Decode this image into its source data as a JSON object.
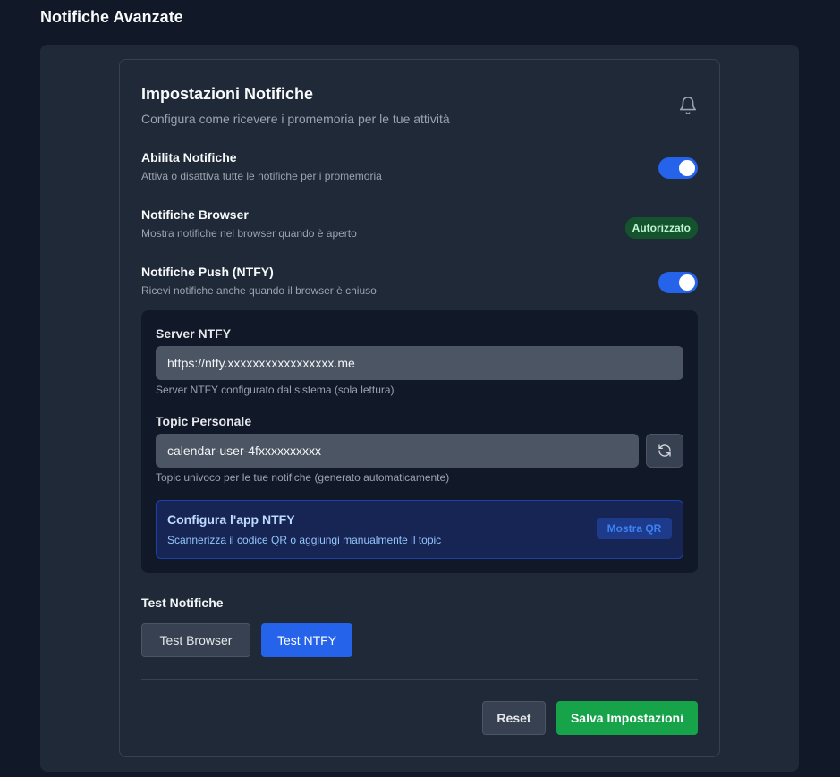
{
  "page": {
    "title": "Notifiche Avanzate"
  },
  "card": {
    "title": "Impostazioni Notifiche",
    "subtitle": "Configura come ricevere i promemoria per le tue attività"
  },
  "settings": [
    {
      "label": "Abilita Notifiche",
      "desc": "Attiva o disattiva tutte le notifiche per i promemoria",
      "enabled": true
    },
    {
      "label": "Notifiche Browser",
      "desc": "Mostra notifiche nel browser quando è aperto",
      "badge": "Autorizzato"
    },
    {
      "label": "Notifiche Push (NTFY)",
      "desc": "Ricevi notifiche anche quando il browser è chiuso",
      "enabled": true
    }
  ],
  "ntfy": {
    "server_label": "Server NTFY",
    "server_value": "https://ntfy.xxxxxxxxxxxxxxxxx.me",
    "server_helper": "Server NTFY configurato dal sistema (sola lettura)",
    "topic_label": "Topic Personale",
    "topic_value": "calendar-user-4fxxxxxxxxxx",
    "topic_helper": "Topic univoco per le tue notifiche (generato automaticamente)",
    "config_title": "Configura l'app NTFY",
    "config_desc": "Scannerizza il codice QR o aggiungi manualmente il topic",
    "qr_button": "Mostra QR"
  },
  "test": {
    "title": "Test Notifiche",
    "browser_button": "Test Browser",
    "ntfy_button": "Test NTFY"
  },
  "actions": {
    "reset": "Reset",
    "save": "Salva Impostazioni"
  },
  "icons": {
    "bell": "bell-icon",
    "refresh": "refresh-icon"
  },
  "colors": {
    "accent": "#2563eb",
    "success": "#16a34a",
    "badge_bg": "#14532d"
  }
}
